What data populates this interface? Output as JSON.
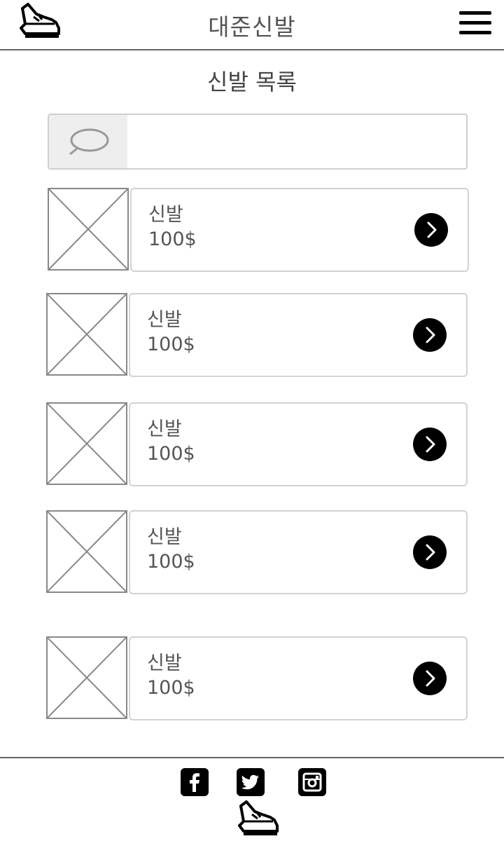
{
  "header": {
    "title": "대준신발",
    "logo_icon": "sneaker-icon",
    "menu_icon": "hamburger-menu-icon"
  },
  "page_title": "신발 목록",
  "search": {
    "icon": "search-icon",
    "value": "",
    "placeholder": ""
  },
  "products": [
    {
      "name": "신발",
      "price": "100$"
    },
    {
      "name": "신발",
      "price": "100$"
    },
    {
      "name": "신발",
      "price": "100$"
    },
    {
      "name": "신발",
      "price": "100$"
    },
    {
      "name": "신발",
      "price": "100$"
    }
  ],
  "footer": {
    "social": [
      "facebook-icon",
      "twitter-icon",
      "instagram-icon"
    ],
    "logo_icon": "sneaker-icon"
  }
}
